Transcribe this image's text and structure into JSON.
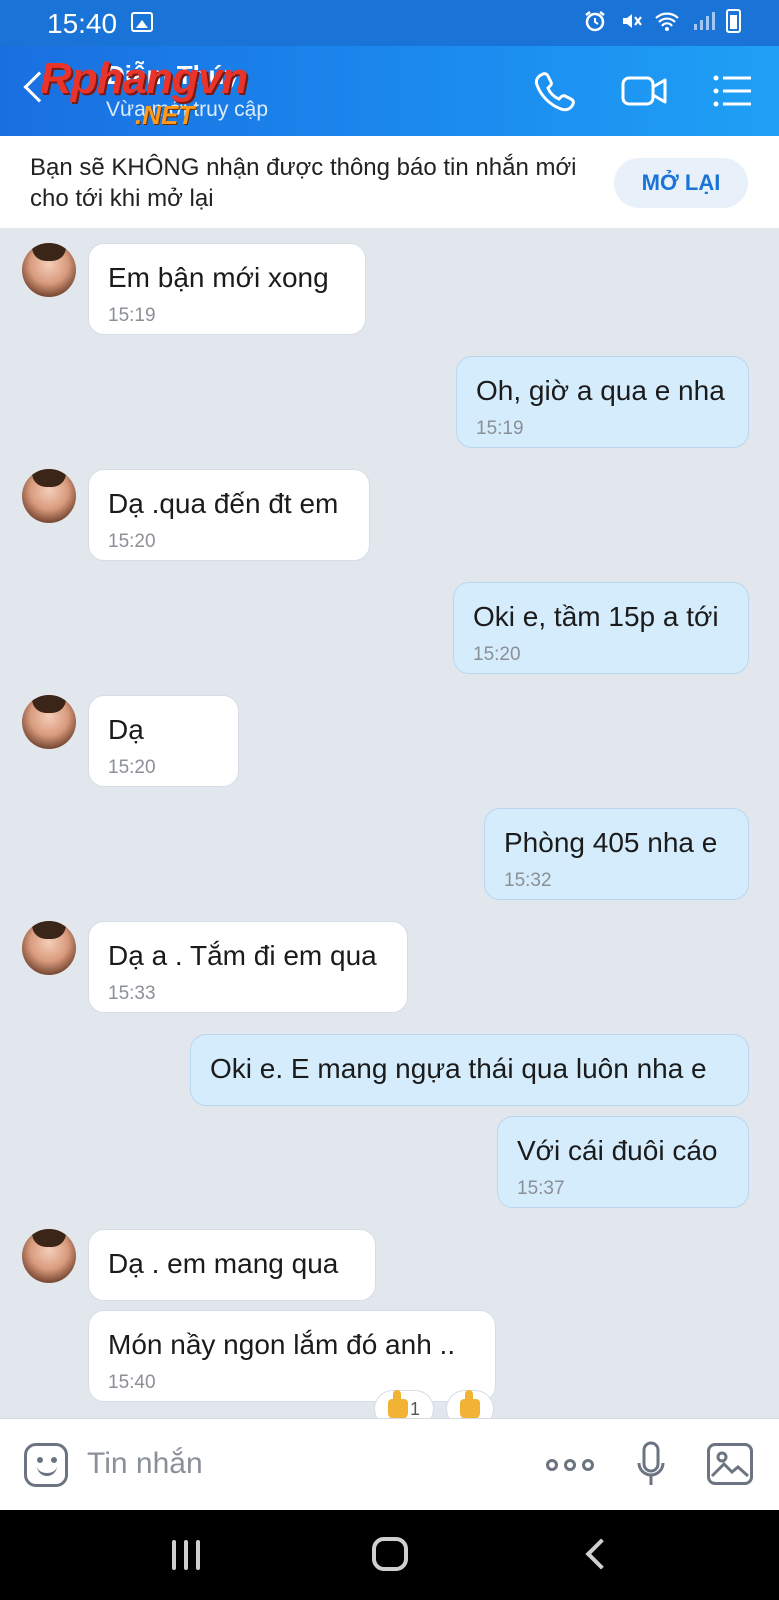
{
  "status_bar": {
    "time": "15:40"
  },
  "header": {
    "contact_name": "Diễm Thúy",
    "contact_status": "Vừa mới truy cập",
    "watermark": "Rphangvn",
    "watermark_sub": ".NET",
    "call_icon": "phone-icon",
    "video_icon": "video-camera-icon",
    "menu_icon": "list-menu-icon"
  },
  "notice": {
    "text": "Bạn sẽ KHÔNG nhận được thông báo tin nhắn mới cho tới khi mở lại",
    "button": "MỞ LẠI"
  },
  "messages": [
    {
      "dir": "in",
      "text": "Em bận mới xong",
      "time": "15:19",
      "avatar": true
    },
    {
      "dir": "out",
      "text": "Oh, giờ a qua e nha",
      "time": "15:19"
    },
    {
      "dir": "in",
      "text": "Dạ .qua đến đt em",
      "time": "15:20",
      "avatar": true
    },
    {
      "dir": "out",
      "text": "Oki e, tầm 15p a tới",
      "time": "15:20"
    },
    {
      "dir": "in",
      "text": "Dạ",
      "time": "15:20",
      "avatar": true
    },
    {
      "dir": "out",
      "text": "Phòng 405 nha e",
      "time": "15:32"
    },
    {
      "dir": "in",
      "text": "Dạ a . Tắm đi em qua",
      "time": "15:33",
      "avatar": true
    },
    {
      "dir": "out",
      "text": "Oki e. E mang ngựa thái qua luôn nha e",
      "time": ""
    },
    {
      "dir": "out",
      "text": "Với cái đuôi cáo",
      "time": "15:37"
    },
    {
      "dir": "in",
      "text": "Dạ . em mang qua",
      "time": "",
      "avatar": true
    },
    {
      "dir": "in",
      "text": "Món nầy ngon lắm đó anh ..",
      "time": "15:40"
    }
  ],
  "reactions": {
    "count": "1"
  },
  "composer": {
    "placeholder": "Tin nhắn"
  },
  "colors": {
    "brand": "#1a73d6",
    "outgoing_bubble": "#d5ecfc",
    "incoming_bubble": "#ffffff",
    "background": "#e2e7ee"
  }
}
